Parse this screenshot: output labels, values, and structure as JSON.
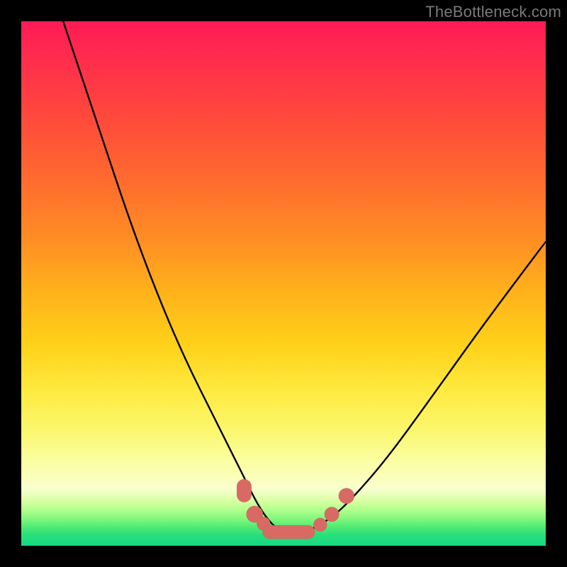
{
  "watermark": "TheBottleneck.com",
  "colors": {
    "gradient_top": "#ff1a55",
    "gradient_mid": "#ffd21a",
    "gradient_bottom": "#14da83",
    "curve": "#000000",
    "markers": "#d96a63",
    "frame": "#000000"
  },
  "chart_data": {
    "type": "line",
    "title": "",
    "xlabel": "",
    "ylabel": "",
    "xlim": [
      0,
      100
    ],
    "ylim": [
      0,
      100
    ],
    "grid": false,
    "legend": false,
    "note": "V-shaped bottleneck curve over a red→yellow→green vertical gradient. Curve values are estimated from pixel positions; y=0 is the green bottom (best), y=100 is the red top (worst).",
    "series": [
      {
        "name": "bottleneck-curve",
        "x": [
          8,
          12,
          16,
          20,
          24,
          28,
          32,
          36,
          40,
          43,
          45,
          47,
          49,
          51,
          53,
          55,
          57,
          60,
          64,
          70,
          78,
          88,
          100
        ],
        "y": [
          100,
          88,
          76,
          64,
          53,
          43,
          34,
          26,
          18,
          12,
          8,
          5,
          3,
          2.5,
          2.5,
          3,
          4,
          6,
          10,
          17,
          28,
          42,
          58
        ]
      }
    ],
    "markers": [
      {
        "shape": "pill",
        "cx": 42.5,
        "cy": 10.5,
        "rx": 1.4,
        "ry": 2.2
      },
      {
        "shape": "circle",
        "cx": 44.5,
        "cy": 6.0,
        "r": 1.6
      },
      {
        "shape": "circle",
        "cx": 46.2,
        "cy": 4.2,
        "r": 1.3
      },
      {
        "shape": "pill-h",
        "cx": 51.0,
        "cy": 2.6,
        "rx": 5.0,
        "ry": 1.3
      },
      {
        "shape": "circle",
        "cx": 57.0,
        "cy": 4.0,
        "r": 1.3
      },
      {
        "shape": "circle",
        "cx": 59.2,
        "cy": 6.0,
        "r": 1.4
      },
      {
        "shape": "circle",
        "cx": 62.0,
        "cy": 9.5,
        "r": 1.5
      }
    ]
  }
}
